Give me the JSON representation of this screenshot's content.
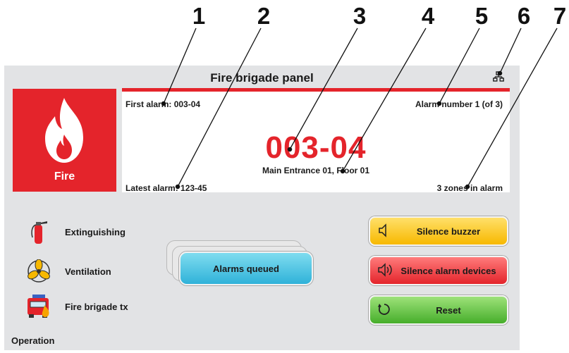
{
  "callouts": [
    "1",
    "2",
    "3",
    "4",
    "5",
    "6",
    "7"
  ],
  "panel": {
    "title": "Fire brigade panel",
    "fire_tile_label": "Fire",
    "alarm": {
      "first_alarm": "First alarm: 003-04",
      "alarm_number": "Alarm number 1 (of 3)",
      "zone": "003-04",
      "location": "Main Entrance 01, Floor 01",
      "latest_alarm": "Latest alarm: 123-45",
      "zones_in_alarm": "3 zones in alarm"
    },
    "operations": [
      {
        "label": "Extinguishing",
        "icon": "fire-extinguisher-icon"
      },
      {
        "label": "Ventilation",
        "icon": "fan-icon"
      },
      {
        "label": "Fire brigade tx",
        "icon": "fire-truck-icon"
      }
    ],
    "operation_label": "Operation",
    "queued_label": "Alarms queued",
    "buttons": {
      "silence_buzzer": "Silence buzzer",
      "silence_devices": "Silence alarm devices",
      "reset": "Reset"
    }
  },
  "colors": {
    "alarm_red": "#e4242b",
    "panel_bg": "#e2e3e5",
    "queued_blue": "#2fb2d9",
    "buzzer_yellow": "#f7b800",
    "reset_green": "#46ae2b"
  }
}
